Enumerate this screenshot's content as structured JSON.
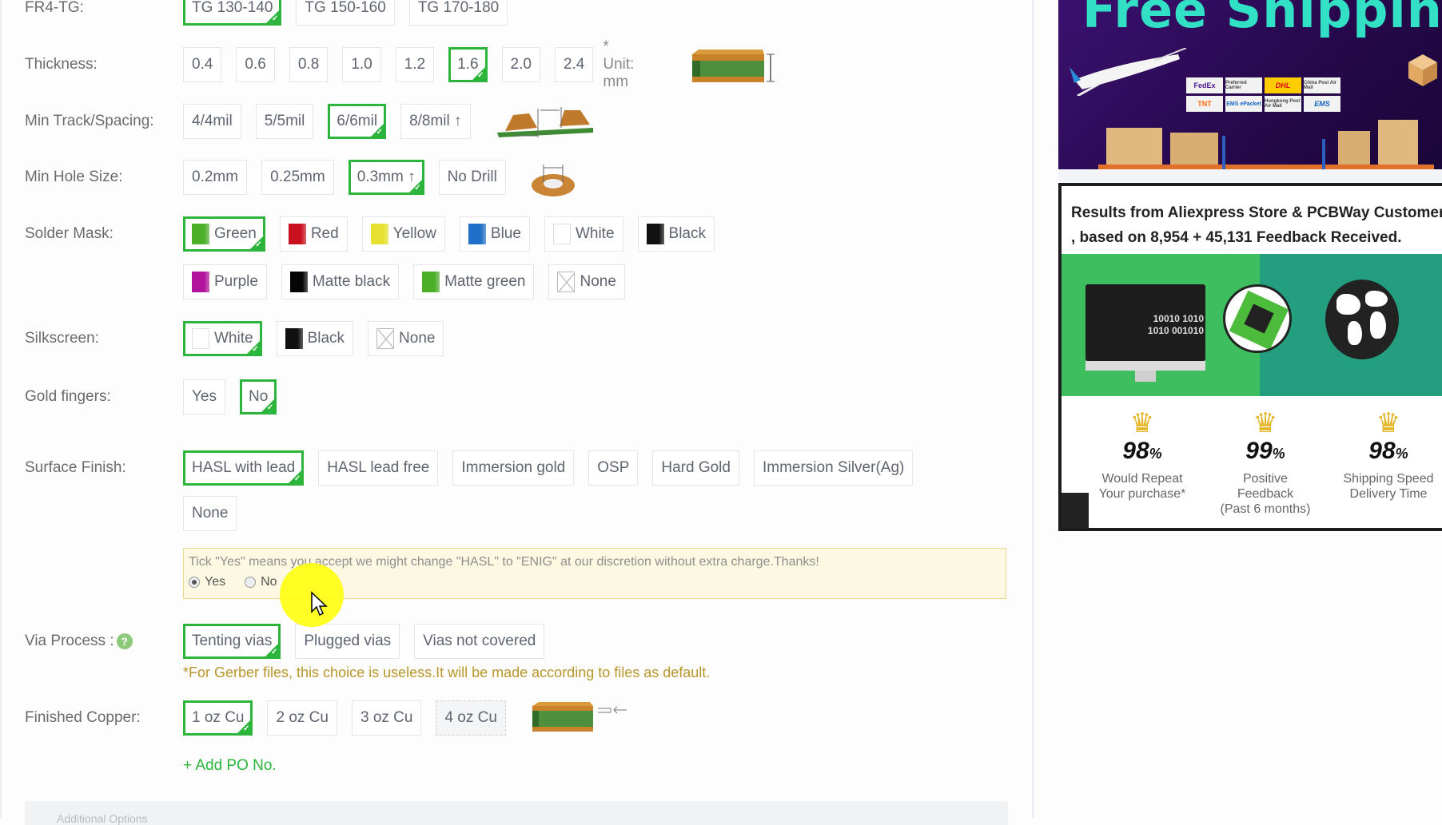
{
  "form": {
    "rows": [
      {
        "key": "fr4tg",
        "label": "FR4-TG:",
        "options": [
          {
            "label": "TG 130-140",
            "selected": true
          },
          {
            "label": "TG 150-160",
            "selected": false
          },
          {
            "label": "TG 170-180",
            "selected": false
          }
        ]
      },
      {
        "key": "thickness",
        "label": "Thickness:",
        "options": [
          {
            "label": "0.4",
            "selected": false
          },
          {
            "label": "0.6",
            "selected": false
          },
          {
            "label": "0.8",
            "selected": false
          },
          {
            "label": "1.0",
            "selected": false
          },
          {
            "label": "1.2",
            "selected": false
          },
          {
            "label": "1.6",
            "selected": true
          },
          {
            "label": "2.0",
            "selected": false
          },
          {
            "label": "2.4",
            "selected": false
          }
        ],
        "unit_note": "* Unit: mm"
      },
      {
        "key": "track",
        "label": "Min Track/Spacing:",
        "options": [
          {
            "label": "4/4mil",
            "selected": false
          },
          {
            "label": "5/5mil",
            "selected": false
          },
          {
            "label": "6/6mil",
            "selected": true
          },
          {
            "label": "8/8mil ↑",
            "selected": false
          }
        ]
      },
      {
        "key": "hole",
        "label": "Min Hole Size:",
        "options": [
          {
            "label": "0.2mm",
            "selected": false
          },
          {
            "label": "0.25mm",
            "selected": false
          },
          {
            "label": "0.3mm ↑",
            "selected": true
          },
          {
            "label": "No Drill",
            "selected": false
          }
        ]
      },
      {
        "key": "mask",
        "label": "Solder Mask:",
        "options": [
          {
            "label": "Green",
            "color": "#4caf2a",
            "selected": true
          },
          {
            "label": "Red",
            "color": "#c8101e",
            "selected": false
          },
          {
            "label": "Yellow",
            "color": "#e6e030",
            "selected": false
          },
          {
            "label": "Blue",
            "color": "#1f6fc8",
            "selected": false
          },
          {
            "label": "White",
            "color": "#ffffff",
            "selected": false
          },
          {
            "label": "Black",
            "color": "#111111",
            "selected": false
          },
          {
            "label": "Purple",
            "color": "#b0139c",
            "selected": false
          },
          {
            "label": "Matte black",
            "color": "#050505",
            "selected": false
          },
          {
            "label": "Matte green",
            "color": "#4caf2a",
            "selected": false
          },
          {
            "label": "None",
            "color": "none",
            "selected": false
          }
        ]
      },
      {
        "key": "silk",
        "label": "Silkscreen:",
        "options": [
          {
            "label": "White",
            "color": "#ffffff",
            "selected": true
          },
          {
            "label": "Black",
            "color": "#111111",
            "selected": false
          },
          {
            "label": "None",
            "color": "none",
            "selected": false
          }
        ]
      },
      {
        "key": "gold",
        "label": "Gold fingers:",
        "options": [
          {
            "label": "Yes",
            "selected": false
          },
          {
            "label": "No",
            "selected": true
          }
        ]
      },
      {
        "key": "finish",
        "label": "Surface Finish:",
        "options": [
          {
            "label": "HASL with lead",
            "selected": true
          },
          {
            "label": "HASL lead free",
            "selected": false
          },
          {
            "label": "Immersion gold",
            "selected": false
          },
          {
            "label": "OSP",
            "selected": false
          },
          {
            "label": "Hard Gold",
            "selected": false
          },
          {
            "label": "Immersion Silver(Ag)",
            "selected": false
          },
          {
            "label": "None",
            "selected": false
          }
        ]
      },
      {
        "key": "via",
        "label": "Via Process :",
        "options": [
          {
            "label": "Tenting vias",
            "selected": true
          },
          {
            "label": "Plugged vias",
            "selected": false
          },
          {
            "label": "Vias not covered",
            "selected": false
          }
        ]
      },
      {
        "key": "copper",
        "label": "Finished Copper:",
        "options": [
          {
            "label": "1 oz Cu",
            "selected": true
          },
          {
            "label": "2 oz Cu",
            "selected": false
          },
          {
            "label": "3 oz Cu",
            "selected": false
          },
          {
            "label": "4 oz Cu",
            "selected": false,
            "disabled": true
          }
        ]
      }
    ],
    "notice": {
      "text": "Tick \"Yes\" means you accept we might change \"HASL\" to \"ENIG\" at our discretion without extra charge.Thanks!",
      "yes_label": "Yes",
      "no_label": "No",
      "selected": "Yes"
    },
    "via_note": "*For Gerber files, this choice is useless.It will be made according to files as default.",
    "help_icon": "?",
    "check_icon": "✓",
    "add_po": "+ Add PO No.",
    "bottom_partial": "Additional Options"
  },
  "ads": {
    "shipping_title": "Free Shipping",
    "carriers": [
      "FedEx",
      "Preferred Carrier",
      "DHL",
      "China Post Air Mail",
      "TNT",
      "EMS ePacket",
      "Hongkong Post Air Mail",
      "EMS"
    ],
    "feedback_line1": "Results from Aliexpress Store & PCBWay Customer",
    "feedback_line2": ", based on 8,954 + 45,131 Feedback Received.",
    "binary1": "10010 1010",
    "binary2": "1010 001010",
    "stats": [
      {
        "value": "98",
        "unit": "%",
        "line1": "Would Repeat",
        "line2": "Your purchase*"
      },
      {
        "value": "99",
        "unit": "%",
        "line1": "Positive Feedback",
        "line2": "(Past 6 months)"
      },
      {
        "value": "98",
        "unit": "%",
        "line1": "Shipping Speed",
        "line2": "Delivery Time"
      }
    ]
  },
  "colors": {
    "accent": "#2cb43d",
    "note": "#b8962a",
    "notice_bg": "#fdf8e1"
  }
}
